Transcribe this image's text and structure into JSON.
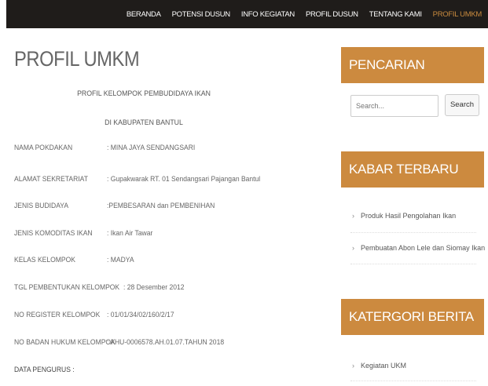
{
  "nav": {
    "items": [
      {
        "label": "BERANDA"
      },
      {
        "label": "POTENSI DUSUN"
      },
      {
        "label": "INFO KEGIATAN"
      },
      {
        "label": "PROFIL DUSUN"
      },
      {
        "label": "TENTANG KAMI"
      },
      {
        "label": "PROFIL UMKM"
      }
    ],
    "active_color": "#c98a3e"
  },
  "main": {
    "title": "PROFIL UMKM",
    "subtitle1": "PROFIL KELOMPOK PEMBUDIDAYA IKAN",
    "subtitle2": "DI KABUPATEN BANTUL",
    "rows": [
      {
        "label": "NAMA POKDAKAN",
        "value": ": MINA JAYA SENDANGSARI"
      },
      {
        "label": "ALAMAT SEKRETARIAT",
        "value": ": Gupakwarak RT. 01 Sendangsari Pajangan Bantul"
      },
      {
        "label": "JENIS BUDIDAYA",
        "value": ":PEMBESARAN dan PEMBENIHAN"
      },
      {
        "label": "JENIS KOMODITAS IKAN",
        "value": ": Ikan Air Tawar"
      },
      {
        "label": "KELAS KELOMPOK",
        "value": ": MADYA"
      },
      {
        "label": "TGL PEMBENTUKAN KELOMPOK",
        "value": ": 28 Desember 2012"
      },
      {
        "label": "NO REGISTER KELOMPOK",
        "value": ": 01/01/34/02/160/2/17"
      },
      {
        "label": "NO BADAN HUKUM KELOMPOK",
        "value": ": AHU-0006578.AH.01.07.TAHUN 2018"
      },
      {
        "label": "DATA PENGURUS :",
        "value": ""
      }
    ]
  },
  "sidebar": {
    "accent": "#cc8a3f",
    "search": {
      "title": "PENCARIAN",
      "placeholder": "Search...",
      "button": "Search"
    },
    "news": {
      "title": "KABAR TERBARU",
      "items": [
        "Produk Hasil Pengolahan Ikan",
        "Pembuatan Abon Lele dan Siomay Ikan"
      ]
    },
    "category": {
      "title": "KATERGORI BERITA",
      "items": [
        "Kegiatan UKM"
      ]
    }
  }
}
